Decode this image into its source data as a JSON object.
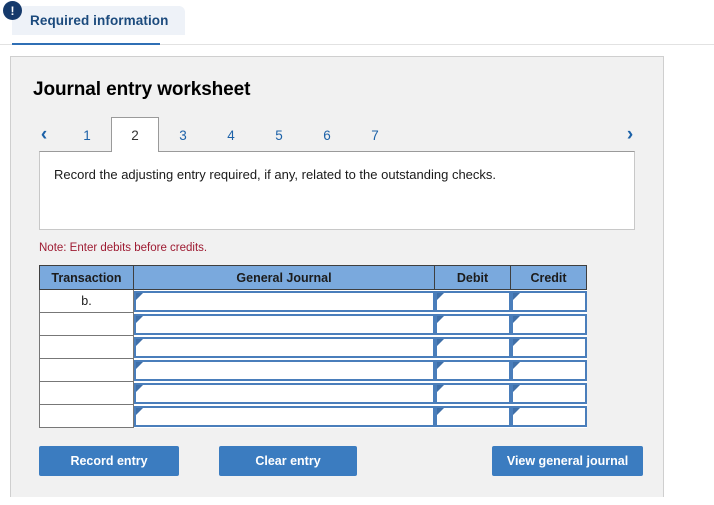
{
  "top_tab": {
    "label": "Required information",
    "badge": "!",
    "badge_name": "exclamation-badge"
  },
  "panel": {
    "title": "Journal entry worksheet",
    "prev_arrow": "‹",
    "next_arrow": "›",
    "tabs": [
      {
        "label": "1",
        "active": false
      },
      {
        "label": "2",
        "active": true
      },
      {
        "label": "3",
        "active": false
      },
      {
        "label": "4",
        "active": false
      },
      {
        "label": "5",
        "active": false
      },
      {
        "label": "6",
        "active": false
      },
      {
        "label": "7",
        "active": false
      }
    ],
    "instruction": "Record the adjusting entry required, if any, related to the outstanding checks.",
    "note": "Note: Enter debits before credits."
  },
  "table": {
    "headers": [
      "Transaction",
      "General Journal",
      "Debit",
      "Credit"
    ],
    "rows": [
      {
        "transaction": "b.",
        "general_journal": "",
        "debit": "",
        "credit": ""
      },
      {
        "transaction": "",
        "general_journal": "",
        "debit": "",
        "credit": ""
      },
      {
        "transaction": "",
        "general_journal": "",
        "debit": "",
        "credit": ""
      },
      {
        "transaction": "",
        "general_journal": "",
        "debit": "",
        "credit": ""
      },
      {
        "transaction": "",
        "general_journal": "",
        "debit": "",
        "credit": ""
      },
      {
        "transaction": "",
        "general_journal": "",
        "debit": "",
        "credit": ""
      }
    ]
  },
  "buttons": {
    "record": "Record entry",
    "clear": "Clear entry",
    "view": "View general journal"
  },
  "colors": {
    "accent_blue": "#3b7cc0",
    "header_blue": "#7aa9dd",
    "tab_link_blue": "#1d62a8",
    "note_red": "#9e1b32",
    "badge_navy": "#15396b",
    "panel_gray": "#f1f1f1"
  }
}
